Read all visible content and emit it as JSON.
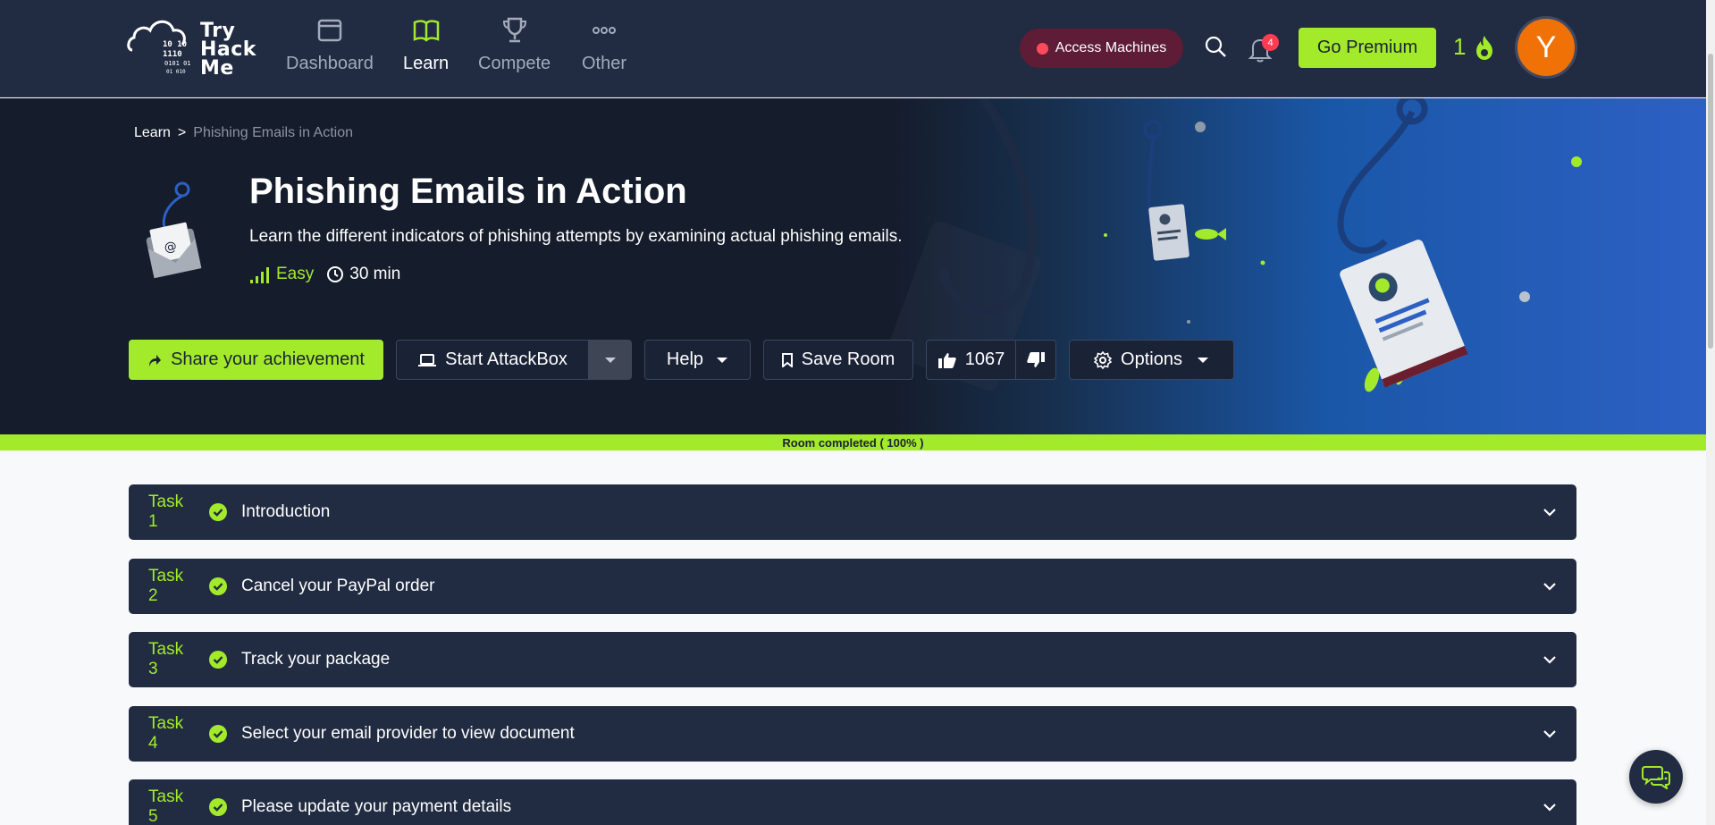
{
  "topnav": {
    "logo_text": [
      "Try",
      "Hack",
      "Me"
    ],
    "items": [
      {
        "label": "Dashboard",
        "icon": "dashboard-icon",
        "active": false
      },
      {
        "label": "Learn",
        "icon": "book-icon",
        "active": true
      },
      {
        "label": "Compete",
        "icon": "trophy-icon",
        "active": false
      },
      {
        "label": "Other",
        "icon": "dots-icon",
        "active": false
      }
    ],
    "access_machines": "Access Machines",
    "notification_count": "4",
    "go_premium": "Go Premium",
    "streak": "1",
    "avatar_letter": "Y"
  },
  "breadcrumb": {
    "root": "Learn",
    "separator": ">",
    "current": "Phishing Emails in Action"
  },
  "room": {
    "title": "Phishing Emails in Action",
    "description": "Learn the different indicators of phishing attempts by examining actual phishing emails.",
    "difficulty": "Easy",
    "duration": "30 min"
  },
  "actions": {
    "share": "Share your achievement",
    "start_attackbox": "Start AttackBox",
    "help": "Help",
    "save_room": "Save Room",
    "likes": "1067",
    "options": "Options"
  },
  "progress": {
    "label": "Room completed ( 100% )",
    "percent": 100
  },
  "tasks": [
    {
      "number": "Task 1",
      "title": "Introduction",
      "completed": true
    },
    {
      "number": "Task 2",
      "title": "Cancel your PayPal order",
      "completed": true
    },
    {
      "number": "Task 3",
      "title": "Track your package",
      "completed": true
    },
    {
      "number": "Task 4",
      "title": "Select your email provider to view document",
      "completed": true
    },
    {
      "number": "Task 5",
      "title": "Please update your payment details",
      "completed": true
    }
  ],
  "colors": {
    "accent": "#a3ea2a",
    "nav_bg": "#212c42",
    "hero_bg": "#151c2b",
    "avatar": "#f07106",
    "access_bg": "#5f1c36"
  }
}
